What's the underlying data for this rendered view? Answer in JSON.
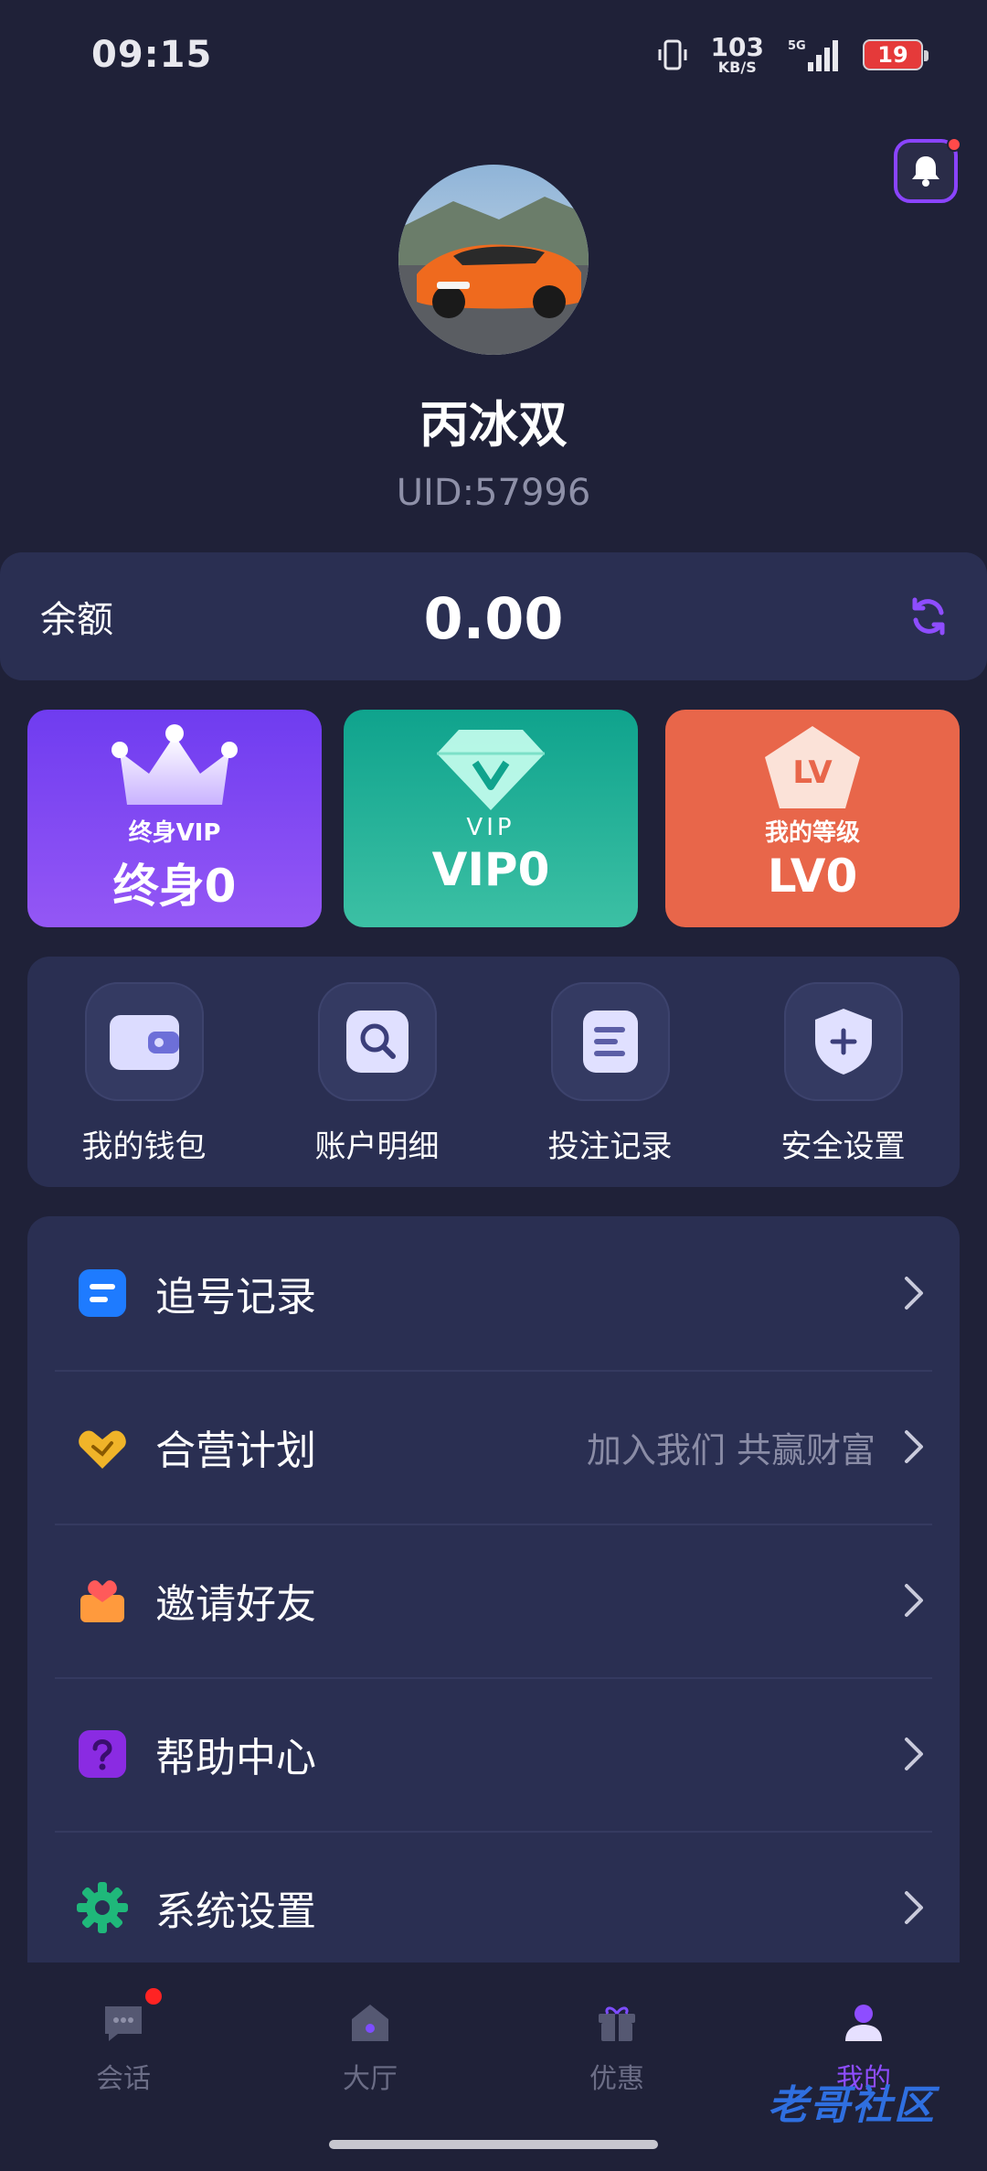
{
  "status_bar": {
    "time": "09:15",
    "net_speed": "103",
    "net_unit": "KB/S",
    "network": "5G",
    "battery": "19"
  },
  "profile": {
    "name": "丙冰双",
    "uid": "UID:57996"
  },
  "balance": {
    "label": "余额",
    "value": "0.00"
  },
  "cards": [
    {
      "small": "终身VIP",
      "big": "终身0"
    },
    {
      "small": "VIP",
      "big": "VIP0"
    },
    {
      "small": "我的等级",
      "big": "LV0",
      "badge": "LV"
    }
  ],
  "quick_actions": [
    {
      "label": "我的钱包",
      "icon": "wallet-icon"
    },
    {
      "label": "账户明细",
      "icon": "search-icon"
    },
    {
      "label": "投注记录",
      "icon": "document-icon"
    },
    {
      "label": "安全设置",
      "icon": "shield-icon"
    }
  ],
  "menu": [
    {
      "label": "追号记录",
      "sub": "",
      "icon": "record-icon",
      "color": "#1e7bff"
    },
    {
      "label": "合营计划",
      "sub": "加入我们 共赢财富",
      "icon": "handshake-icon",
      "color": "#f0b429"
    },
    {
      "label": "邀请好友",
      "sub": "",
      "icon": "invite-icon",
      "color": "#ff6b4a"
    },
    {
      "label": "帮助中心",
      "sub": "",
      "icon": "help-icon",
      "color": "#8a2be2"
    },
    {
      "label": "系统设置",
      "sub": "",
      "icon": "gear-icon",
      "color": "#1fb87a"
    }
  ],
  "nav": [
    {
      "label": "会话",
      "icon": "chat-icon"
    },
    {
      "label": "大厅",
      "icon": "home-icon"
    },
    {
      "label": "优惠",
      "icon": "gift-icon"
    },
    {
      "label": "我的",
      "icon": "profile-icon"
    }
  ],
  "watermark": "老哥社区",
  "colors": {
    "background": "#1f2138",
    "panel": "#2a2f52",
    "accent": "#8e4dff"
  }
}
